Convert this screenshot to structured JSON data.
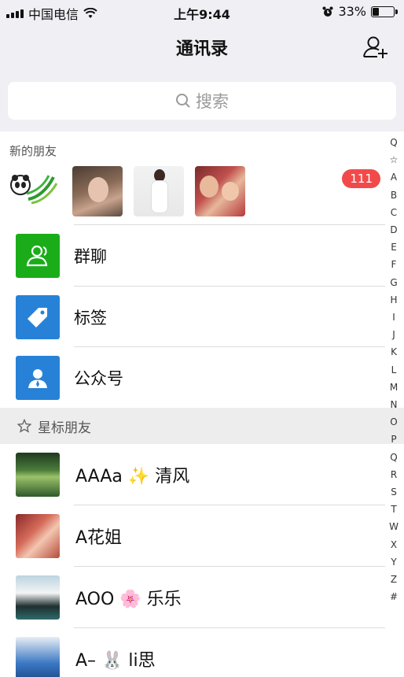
{
  "status_bar": {
    "carrier": "中国电信",
    "time": "上午9:44",
    "battery": "33%",
    "battery_level": 0.33
  },
  "nav": {
    "title": "通讯录"
  },
  "search": {
    "placeholder": "搜索"
  },
  "new_friends": {
    "label": "新的朋友",
    "badge": "111"
  },
  "menu": [
    {
      "label": "群聊",
      "color": "#1aad19",
      "icon": "group-chat-icon"
    },
    {
      "label": "标签",
      "color": "#2782d7",
      "icon": "tag-icon"
    },
    {
      "label": "公众号",
      "color": "#2782d7",
      "icon": "official-account-icon"
    }
  ],
  "starred": {
    "header": "星标朋友",
    "contacts": [
      {
        "name": "AAAa ✨ 清风"
      },
      {
        "name": "A花姐"
      },
      {
        "name": "AOO 🌸 乐乐"
      },
      {
        "name": "A– 🐰 li思"
      }
    ]
  },
  "index_letters": [
    "Q",
    "☆",
    "A",
    "B",
    "C",
    "D",
    "E",
    "F",
    "G",
    "H",
    "I",
    "J",
    "K",
    "L",
    "M",
    "N",
    "O",
    "P",
    "Q",
    "R",
    "S",
    "T",
    "W",
    "X",
    "Y",
    "Z",
    "#"
  ]
}
